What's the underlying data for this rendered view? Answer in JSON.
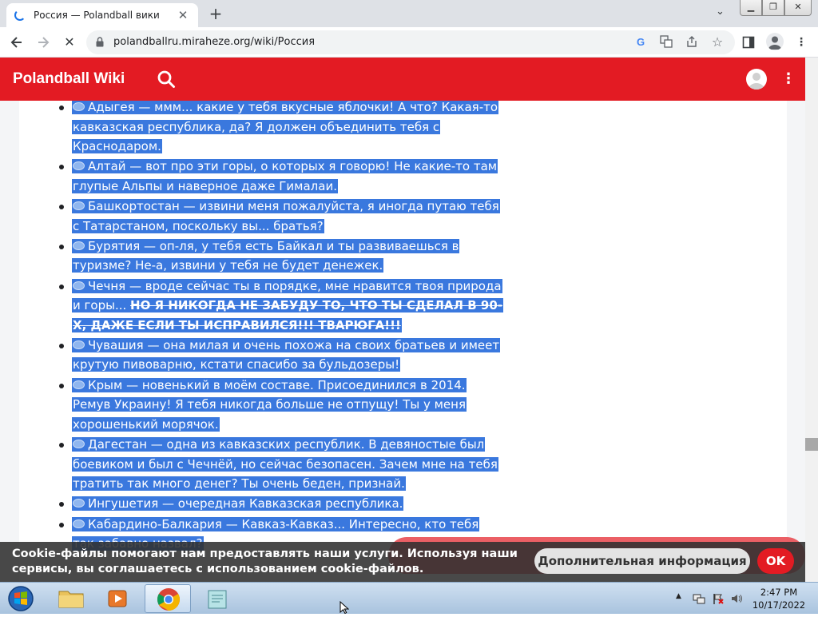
{
  "browser": {
    "tab_title": "Россия — Polandball вики",
    "url": "polandballru.miraheze.org/wiki/Россия"
  },
  "wiki": {
    "site_name": "Polandball Wiki",
    "accent_color": "#e31b23"
  },
  "list_items": [
    {
      "text": "Адыгея — ммм... какие у тебя вкусные яблочки! А что? Какая-то кавказская республика, да? Я должен объединить тебя с Краснодаром.",
      "strike": ""
    },
    {
      "text": "Алтай — вот про эти горы, о которых я говорю! Не какие-то там глупые Альпы и наверное даже Гималаи.",
      "strike": ""
    },
    {
      "text": "Башкортостан — извини меня пожалуйста, я иногда путаю тебя с Татарстаном, поскольку вы... братья?",
      "strike": ""
    },
    {
      "text": "Бурятия — оп-ля, у тебя есть Байкал и ты развиваешься в туризме? Не-а, извини у тебя не будет денежек.",
      "strike": ""
    },
    {
      "text": "Чечня — вроде сейчас ты в порядке, мне нравится твоя природа и горы...",
      "strike": "НО Я НИКОГДА НЕ ЗАБУДУ ТО, ЧТО ТЫ СДЕЛАЛ В 90-Х, ДАЖЕ ЕСЛИ ТЫ ИСПРАВИЛСЯ!!! ТВАРЮГА!!!"
    },
    {
      "text": "Чувашия — она милая и очень похожа на своих братьев и имеет крутую пивоварню, кстати спасибо за бульдозеры!",
      "strike": ""
    },
    {
      "text": "Крым — новенький в моём составе. Присоединился в 2014. Ремув Украину! Я тебя никогда больше не отпущу! Ты у меня хорошенький морячок.",
      "strike": ""
    },
    {
      "text": "Дагестан — одна из кавказских республик. В девяностые был боевиком и был с Чечнёй, но сейчас безопасен. Зачем мне на тебя тратить так много денег? Ты очень беден, признай.",
      "strike": ""
    },
    {
      "text": "Ингушетия — очередная Кавказская республика.",
      "strike": ""
    },
    {
      "text": "Кабардино-Балкария — Кавказ-Кавказ... Интересно, кто тебя так забавно назвал?",
      "strike": ""
    }
  ],
  "cookie": {
    "message": "Cookie-файлы помогают нам предоставлять наши услуги. Используя наши сервисы, вы соглашаетесь с использованием cookie-файлов.",
    "more_label": "Дополнительная информация",
    "ok_label": "OK"
  },
  "taskbar": {
    "time": "2:47 PM",
    "date": "10/17/2022"
  }
}
